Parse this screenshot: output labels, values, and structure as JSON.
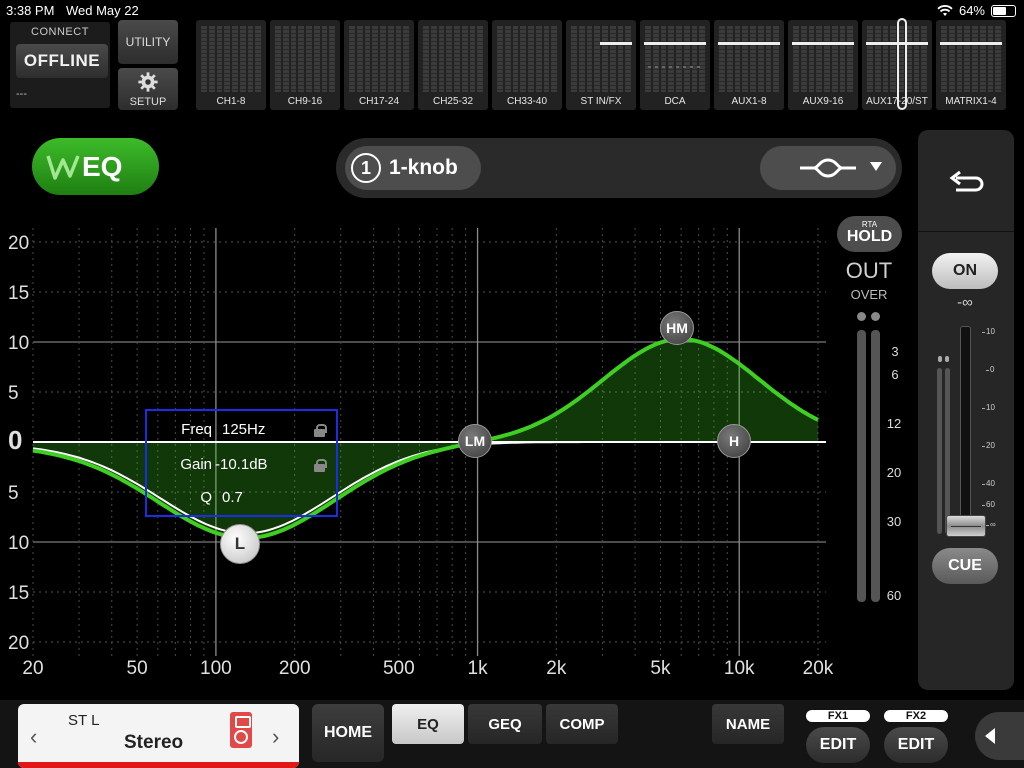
{
  "status": {
    "time": "3:38 PM",
    "date": "Wed May 22",
    "battery": "64%",
    "battery_level": 0.64,
    "icons": [
      "wifi-icon",
      "battery-icon"
    ]
  },
  "nav": {
    "connect_label": "CONNECT",
    "offline_label": "OFFLINE",
    "dashes": "---",
    "utility_label": "UTILITY",
    "setup_label": "SETUP",
    "banks": [
      "CH1-8",
      "CH9-16",
      "CH17-24",
      "CH25-32",
      "CH33-40",
      "ST IN/FX",
      "DCA",
      "AUX1-8",
      "AUX9-16",
      "AUX17-20/ST",
      "MATRIX1-4"
    ]
  },
  "header": {
    "logo_label": "EQ",
    "knob_number": "1",
    "knob_label": "1-knob",
    "eq_type_icon": "eq-curve-icon"
  },
  "graph": {
    "y_ticks": [
      "20",
      "15",
      "10",
      "5",
      "0",
      "5",
      "10",
      "15",
      "20"
    ],
    "x_ticks": [
      "20",
      "50",
      "100",
      "200",
      "500",
      "1k",
      "2k",
      "5k",
      "10k",
      "20k"
    ],
    "curve_color": "#3ecf22"
  },
  "params": {
    "freq_label": "Freq",
    "freq_value": "125Hz",
    "gain_label": "Gain",
    "gain_value": "-10.1dB",
    "q_label": "Q",
    "q_value": "0.7"
  },
  "bands": {
    "low": "L",
    "low_mid": "LM",
    "high_mid": "HM",
    "high": "H"
  },
  "meter": {
    "rta_small": "RTA",
    "rta_hold": "HOLD",
    "out_label": "OUT",
    "over_label": "OVER",
    "scale": [
      "3",
      "6",
      "12",
      "20",
      "30",
      "60"
    ]
  },
  "panel": {
    "back_icon": "undo-arrow-icon",
    "on_label": "ON",
    "level": "-∞",
    "fader_scale": [
      "10",
      "0",
      "10",
      "20",
      "40",
      "60",
      "∞"
    ],
    "cue_label": "CUE"
  },
  "bottom": {
    "channel_name": "ST L",
    "channel_type": "Stereo",
    "home_label": "HOME",
    "tabs": {
      "eq": "EQ",
      "geq": "GEQ",
      "comp": "COMP"
    },
    "name_label": "NAME",
    "fx1": "FX1",
    "fx2": "FX2",
    "edit1": "EDIT",
    "edit2": "EDIT",
    "accent_color": "#e01818"
  }
}
